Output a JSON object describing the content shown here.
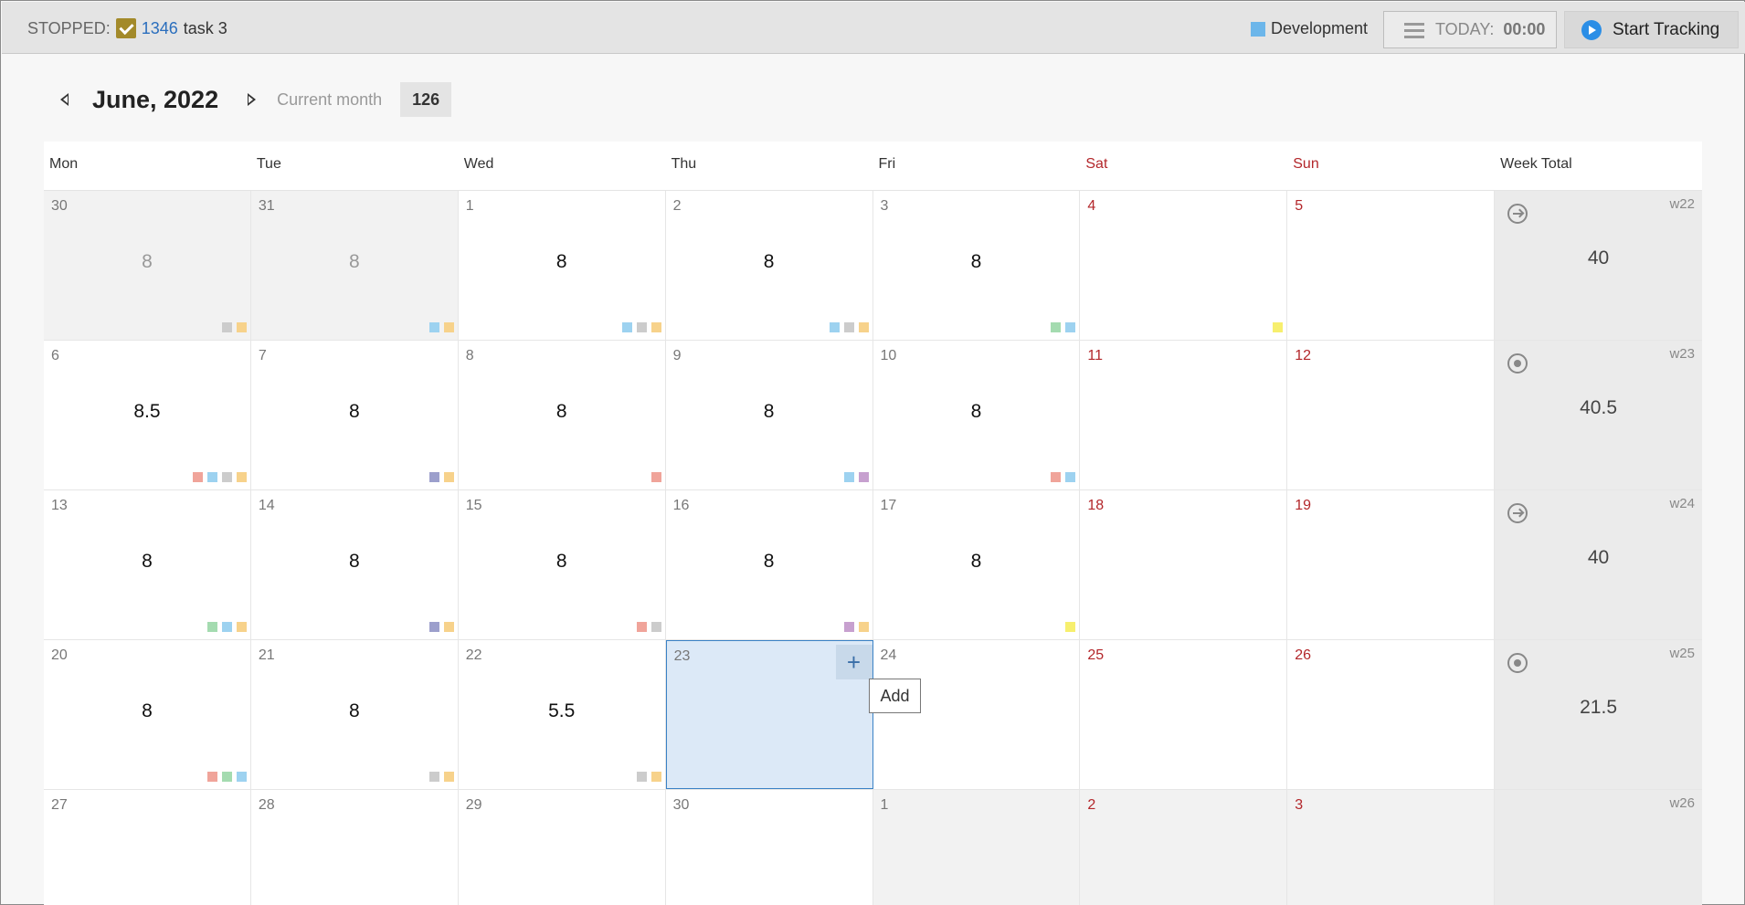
{
  "topbar": {
    "status_label": "STOPPED:",
    "task_id": "1346",
    "task_name": "task 3",
    "project_name": "Development",
    "project_color": "#6cb6ea",
    "today_label": "TODAY:",
    "today_time": "00:00",
    "start_label": "Start Tracking"
  },
  "month": {
    "title": "June, 2022",
    "current_month_label": "Current month",
    "total": "126"
  },
  "headers": [
    "Mon",
    "Tue",
    "Wed",
    "Thu",
    "Fri",
    "Sat",
    "Sun",
    "Week Total"
  ],
  "colors": {
    "gray": "#cccccc",
    "orange": "#f7d28b",
    "blue": "#9dd2f0",
    "green": "#a4dbb0",
    "yellow": "#f7ef6e",
    "red": "#f0a49a",
    "purple": "#9c9fcc",
    "violet": "#c7a0cf"
  },
  "weeks": [
    {
      "label": "w22",
      "total": "40",
      "icon": "arrow",
      "days": [
        {
          "num": "30",
          "hours": "8",
          "other": true,
          "swatches": [
            "gray",
            "orange"
          ]
        },
        {
          "num": "31",
          "hours": "8",
          "other": true,
          "swatches": [
            "blue",
            "orange"
          ]
        },
        {
          "num": "1",
          "hours": "8",
          "swatches": [
            "blue",
            "gray",
            "orange"
          ]
        },
        {
          "num": "2",
          "hours": "8",
          "swatches": [
            "blue",
            "gray",
            "orange"
          ]
        },
        {
          "num": "3",
          "hours": "8",
          "swatches": [
            "green",
            "blue"
          ]
        },
        {
          "num": "4",
          "hours": "",
          "weekend": true,
          "swatches": [
            "yellow"
          ]
        },
        {
          "num": "5",
          "hours": "",
          "weekend": true,
          "swatches": []
        }
      ]
    },
    {
      "label": "w23",
      "total": "40.5",
      "icon": "dot",
      "days": [
        {
          "num": "6",
          "hours": "8.5",
          "swatches": [
            "red",
            "blue",
            "gray",
            "orange"
          ]
        },
        {
          "num": "7",
          "hours": "8",
          "swatches": [
            "purple",
            "orange"
          ]
        },
        {
          "num": "8",
          "hours": "8",
          "swatches": [
            "red"
          ]
        },
        {
          "num": "9",
          "hours": "8",
          "swatches": [
            "blue",
            "violet"
          ]
        },
        {
          "num": "10",
          "hours": "8",
          "swatches": [
            "red",
            "blue"
          ]
        },
        {
          "num": "11",
          "hours": "",
          "weekend": true,
          "swatches": []
        },
        {
          "num": "12",
          "hours": "",
          "weekend": true,
          "swatches": []
        }
      ]
    },
    {
      "label": "w24",
      "total": "40",
      "icon": "arrow",
      "days": [
        {
          "num": "13",
          "hours": "8",
          "swatches": [
            "green",
            "blue",
            "orange"
          ]
        },
        {
          "num": "14",
          "hours": "8",
          "swatches": [
            "purple",
            "orange"
          ]
        },
        {
          "num": "15",
          "hours": "8",
          "swatches": [
            "red",
            "gray"
          ]
        },
        {
          "num": "16",
          "hours": "8",
          "swatches": [
            "violet",
            "orange"
          ]
        },
        {
          "num": "17",
          "hours": "8",
          "swatches": [
            "yellow"
          ]
        },
        {
          "num": "18",
          "hours": "",
          "weekend": true,
          "swatches": []
        },
        {
          "num": "19",
          "hours": "",
          "weekend": true,
          "swatches": []
        }
      ]
    },
    {
      "label": "w25",
      "total": "21.5",
      "icon": "dot",
      "days": [
        {
          "num": "20",
          "hours": "8",
          "swatches": [
            "red",
            "green",
            "blue"
          ]
        },
        {
          "num": "21",
          "hours": "8",
          "swatches": [
            "gray",
            "orange"
          ]
        },
        {
          "num": "22",
          "hours": "5.5",
          "swatches": [
            "gray",
            "orange"
          ]
        },
        {
          "num": "23",
          "hours": "",
          "selected": true,
          "swatches": []
        },
        {
          "num": "24",
          "hours": "",
          "swatches": []
        },
        {
          "num": "25",
          "hours": "",
          "weekend": true,
          "swatches": []
        },
        {
          "num": "26",
          "hours": "",
          "weekend": true,
          "swatches": []
        }
      ]
    },
    {
      "label": "w26",
      "total": "",
      "icon": "",
      "days": [
        {
          "num": "27",
          "hours": "",
          "swatches": []
        },
        {
          "num": "28",
          "hours": "",
          "swatches": []
        },
        {
          "num": "29",
          "hours": "",
          "swatches": []
        },
        {
          "num": "30",
          "hours": "",
          "swatches": []
        },
        {
          "num": "1",
          "hours": "",
          "other": true,
          "swatches": []
        },
        {
          "num": "2",
          "hours": "",
          "other": true,
          "weekend": true,
          "swatches": []
        },
        {
          "num": "3",
          "hours": "",
          "other": true,
          "weekend": true,
          "swatches": []
        }
      ]
    }
  ],
  "add_button": {
    "symbol": "+",
    "tooltip": "Add"
  }
}
